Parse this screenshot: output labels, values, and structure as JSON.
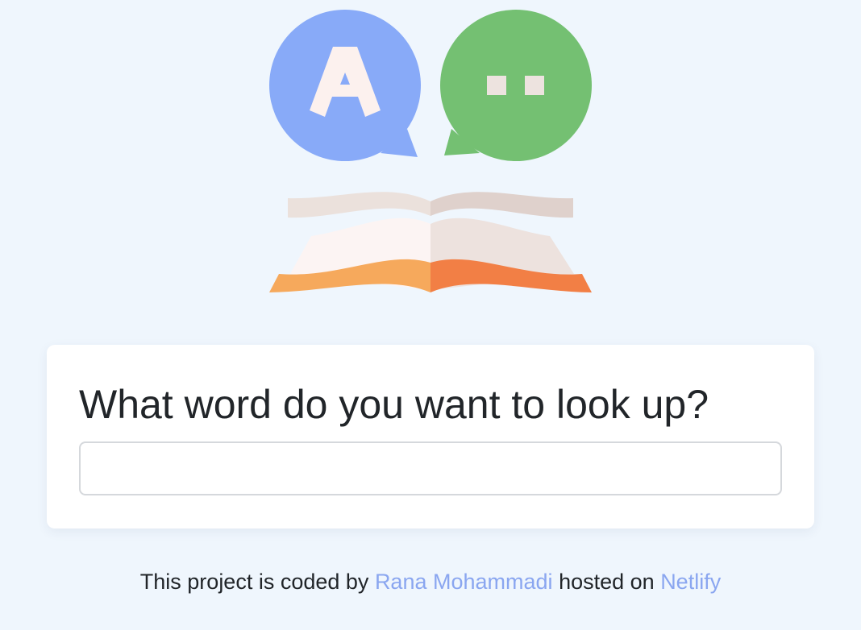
{
  "logo": {
    "bubble_left_letter": "A",
    "colors": {
      "bubble_left": "#88aaf8",
      "bubble_right": "#74c072",
      "glyph": "#fcf1ee",
      "page_light": "#fcf4f3",
      "page_shade": "#ede2de",
      "page_top_left": "#ebe1dc",
      "page_top_right": "#dfd1cc",
      "edge_left": "#f6a95c",
      "edge_right": "#f27f45"
    }
  },
  "search": {
    "heading": "What word do you want to look up?",
    "input_value": "",
    "placeholder": ""
  },
  "footer": {
    "prefix": "This project is coded by",
    "author_link": "Rana Mohammadi",
    "middle": "hosted on",
    "host_link": "Netlify",
    "link_color": "#8aa6f0"
  }
}
